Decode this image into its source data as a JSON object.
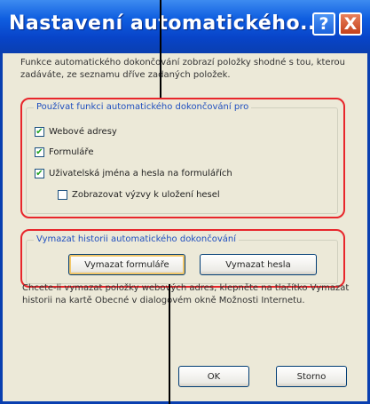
{
  "window": {
    "title": "Nastavení automatického...",
    "help_label": "?",
    "close_label": "X"
  },
  "description": "Funkce automatického dokončování zobrazí položky shodné s tou, kterou zadáváte, ze seznamu dříve zadaných položek.",
  "use_group": {
    "label": "Používat funkci automatického dokončování pro",
    "items": [
      {
        "label": "Webové adresy",
        "checked": true
      },
      {
        "label": "Formuláře",
        "checked": true
      },
      {
        "label": "Uživatelská jména a hesla na formulářích",
        "checked": true
      },
      {
        "label": "Zobrazovat výzvy k uložení hesel",
        "checked": false
      }
    ]
  },
  "clear_group": {
    "label": "Vymazat historii automatického dokončování",
    "clear_forms_label": "Vymazat formuláře",
    "clear_passwords_label": "Vymazat hesla"
  },
  "info_text": "Chcete-li vymazat položky webových adres, klepněte na tlačítko Vymazat historii na kartě Obecné v dialogovém okně Možnosti Internetu.",
  "footer": {
    "ok_label": "OK",
    "cancel_label": "Storno"
  },
  "colors": {
    "titlebar": "#0a3fb0",
    "highlight": "#e8262b",
    "group_label": "#1f4fbf",
    "check": "#21a121"
  }
}
